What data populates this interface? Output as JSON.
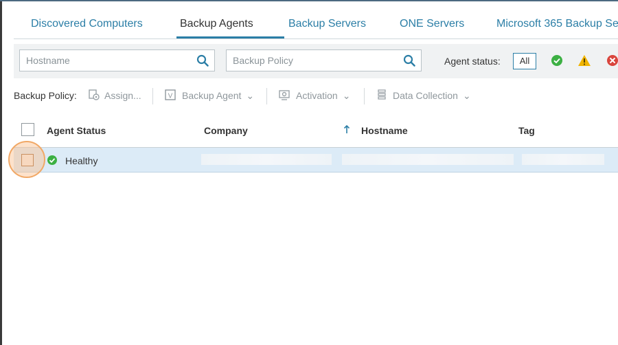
{
  "tabs": [
    {
      "label": "Discovered Computers",
      "active": false
    },
    {
      "label": "Backup Agents",
      "active": true
    },
    {
      "label": "Backup Servers",
      "active": false
    },
    {
      "label": "ONE Servers",
      "active": false
    },
    {
      "label": "Microsoft 365 Backup Se",
      "active": false
    }
  ],
  "filters": {
    "hostname_placeholder": "Hostname",
    "policy_placeholder": "Backup Policy",
    "agent_status_label": "Agent status:",
    "all_label": "All"
  },
  "toolbar": {
    "backup_policy_label": "Backup Policy:",
    "assign_label": "Assign...",
    "backup_agent_label": "Backup Agent",
    "activation_label": "Activation",
    "data_collection_label": "Data Collection"
  },
  "grid": {
    "columns": [
      "Agent Status",
      "Company",
      "Hostname",
      "Tag"
    ],
    "rows": [
      {
        "agent_status": "Healthy",
        "company": "",
        "hostname": "",
        "tag": ""
      }
    ]
  },
  "colors": {
    "accent": "#2b7ea6",
    "ok": "#3cb043",
    "warning": "#f0b400",
    "error": "#d9453d",
    "row_selected": "#dcebf7"
  }
}
